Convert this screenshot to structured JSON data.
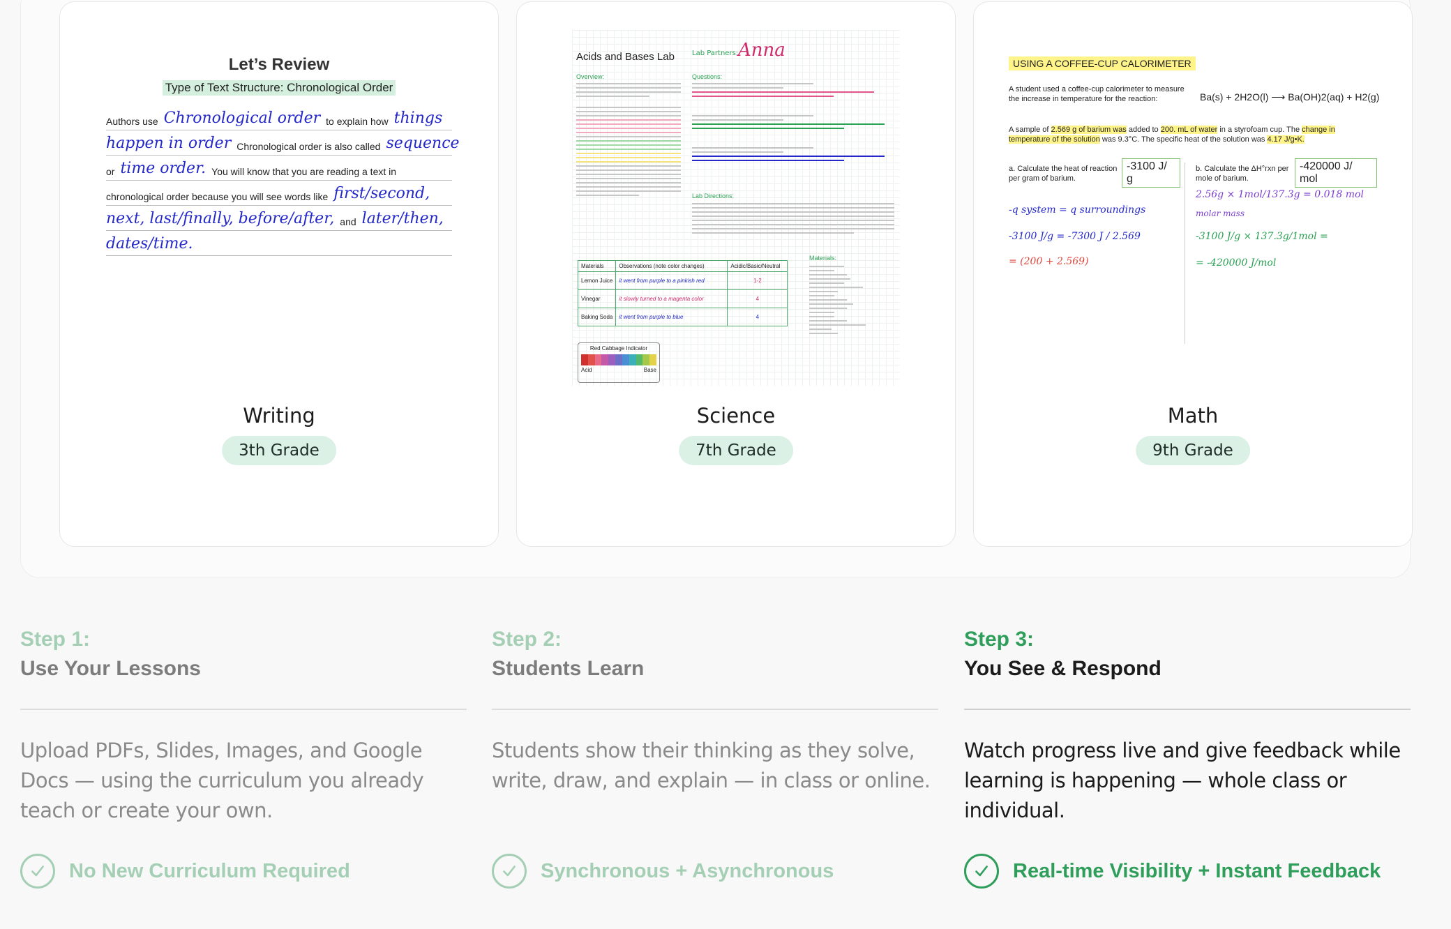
{
  "cards": [
    {
      "title": "Writing",
      "grade": "3th Grade",
      "worksheet": {
        "title": "Let’s Review",
        "subtitle": "Type of Text Structure: Chronological Order",
        "line1_a": "Authors use",
        "line1_hand": "Chronological order",
        "line1_b": "to explain how",
        "line1_hand2": "things",
        "line2_hand": "happen in order",
        "line2_a": "Chronological order is also called",
        "line2_hand2": "sequence",
        "line3_a": "or",
        "line3_hand": "time order.",
        "line3_b": "You will know that you are reading a text in",
        "line4_a": "chronological order because you will see words like",
        "line4_hand": "first/second,",
        "line5_hand": "next, last/finally, before/after,",
        "line5_a": "and",
        "line5_hand2": "later/then,",
        "line6_hand": "dates/time."
      }
    },
    {
      "title": "Science",
      "grade": "7th Grade",
      "worksheet": {
        "title": "Acids and Bases Lab",
        "partners_label": "Lab Partners:",
        "partner_name": "Anna",
        "overview": "Overview:",
        "questions": "Questions:",
        "directions": "Lab Directions:",
        "materials": "Materials:",
        "table_headers": [
          "Materials",
          "Observations (note color changes)",
          "Acidic/Basic/Neutral"
        ],
        "table_rows": [
          {
            "material": "Lemon Juice",
            "obs": "it went from purple to a pinkish red",
            "ph": "1-2"
          },
          {
            "material": "Vinegar",
            "obs": "it slowly turned to a magenta color",
            "ph": "4"
          },
          {
            "material": "Baking Soda",
            "obs": "it went from purple to blue",
            "ph": "4"
          }
        ],
        "indicator_title": "Red Cabbage Indicator",
        "indicator_acid": "Acid",
        "indicator_base": "Base"
      }
    },
    {
      "title": "Math",
      "grade": "9th Grade",
      "worksheet": {
        "title": "USING A COFFEE-CUP CALORIMETER",
        "intro": "A student used a coffee-cup calorimeter to measure the increase in temperature for the reaction:",
        "equation": "Ba(s) + 2H2O(l) ⟶ Ba(OH)2(aq) + H2(g)",
        "sample_a": "A sample of",
        "sample_hl1": "2.569 g of barium was",
        "sample_b": "added to",
        "sample_hl2": "200. mL of water",
        "sample_c": "in a styrofoam cup. The",
        "sample_hl3": "change in temperature of the solution",
        "sample_d": "was 9.3°C. The specific heat of the solution was",
        "sample_hl4": "4.17 J/g•K.",
        "q_a": "a. Calculate the heat of reaction per gram of barium.",
        "ans_a": "-3100 J/ g",
        "q_b": "b. Calculate the ΔH°rxn per mole of barium.",
        "ans_b": "-420000 J/ mol",
        "work_a1": "-q system = q surroundings",
        "work_a2": "-3100 J/g = -7300 J / 2.569",
        "work_a3": "= (200 + 2.569)",
        "work_b1": "2.56g × 1mol/137.3g = 0.018 mol",
        "work_b2": "molar mass",
        "work_b3": "-3100 J/g × 137.3g/1mol =",
        "work_b4": "= -420000 J/mol"
      }
    }
  ],
  "steps": [
    {
      "number": "Step 1:",
      "name": "Use Your Lessons",
      "description": "Upload PDFs, Slides, Images, and Google Docs — using the curriculum you already teach or create your own.",
      "feature": "No New Curriculum Required"
    },
    {
      "number": "Step 2:",
      "name": "Students Learn",
      "description": "Students show their thinking as they solve, write, draw, and explain — in class or online.",
      "feature": "Synchronous + Asynchronous"
    },
    {
      "number": "Step 3:",
      "name": "You See & Respond",
      "description": "Watch progress live and give feedback while learning is happening — whole class or individual.",
      "feature": "Real-time Visibility + Instant Feedback"
    }
  ],
  "colors": {
    "accent_green": "#2f9e5b",
    "muted_green": "#a5cfb5",
    "pill_bg": "#dcf1e6"
  }
}
